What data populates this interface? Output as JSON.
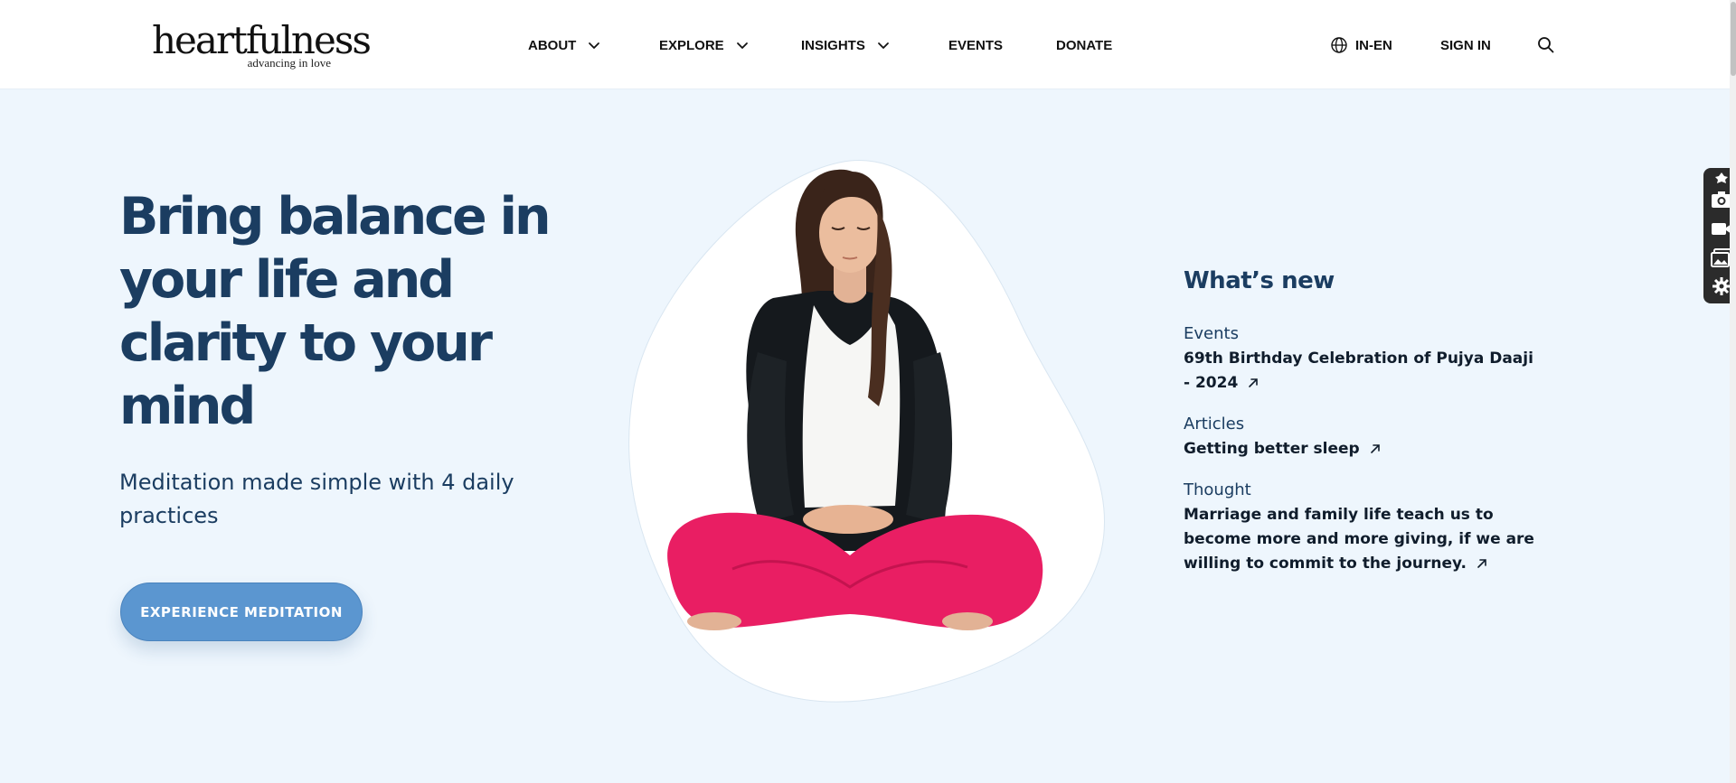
{
  "brand": {
    "logo_text": "heartfulness",
    "tagline": "advancing in love"
  },
  "nav": {
    "items": [
      {
        "label": "ABOUT",
        "has_dropdown": true
      },
      {
        "label": "EXPLORE",
        "has_dropdown": true
      },
      {
        "label": "INSIGHTS",
        "has_dropdown": true
      },
      {
        "label": "EVENTS",
        "has_dropdown": false
      },
      {
        "label": "DONATE",
        "has_dropdown": false
      }
    ],
    "locale": "IN-EN",
    "signin": "SIGN IN"
  },
  "hero": {
    "title": "Bring balance in your life and clarity to your mind",
    "subtitle": "Meditation made simple with 4 daily practices",
    "cta": "EXPERIENCE MEDITATION"
  },
  "whats_new": {
    "title": "What’s new",
    "entries": [
      {
        "category": "Events",
        "text": "69th Birthday Celebration of Pujya Daaji - 2024"
      },
      {
        "category": "Articles",
        "text": "Getting better sleep"
      },
      {
        "category": "Thought",
        "text": "Marriage and family life teach us to become more and more giving, if we are willing to commit to the journey."
      }
    ]
  },
  "icons": {
    "dropdown": "chevron-down-icon",
    "locale": "globe-icon",
    "search": "search-icon",
    "external": "arrow-up-right-icon",
    "toolbar": [
      "pin-icon",
      "camera-icon",
      "video-icon",
      "gallery-icon",
      "gear-icon"
    ]
  },
  "colors": {
    "heading": "#1b3d61",
    "page_background": "#eef6fd",
    "cta_background": "#5b96d0",
    "legging_pink": "#e91e63"
  }
}
